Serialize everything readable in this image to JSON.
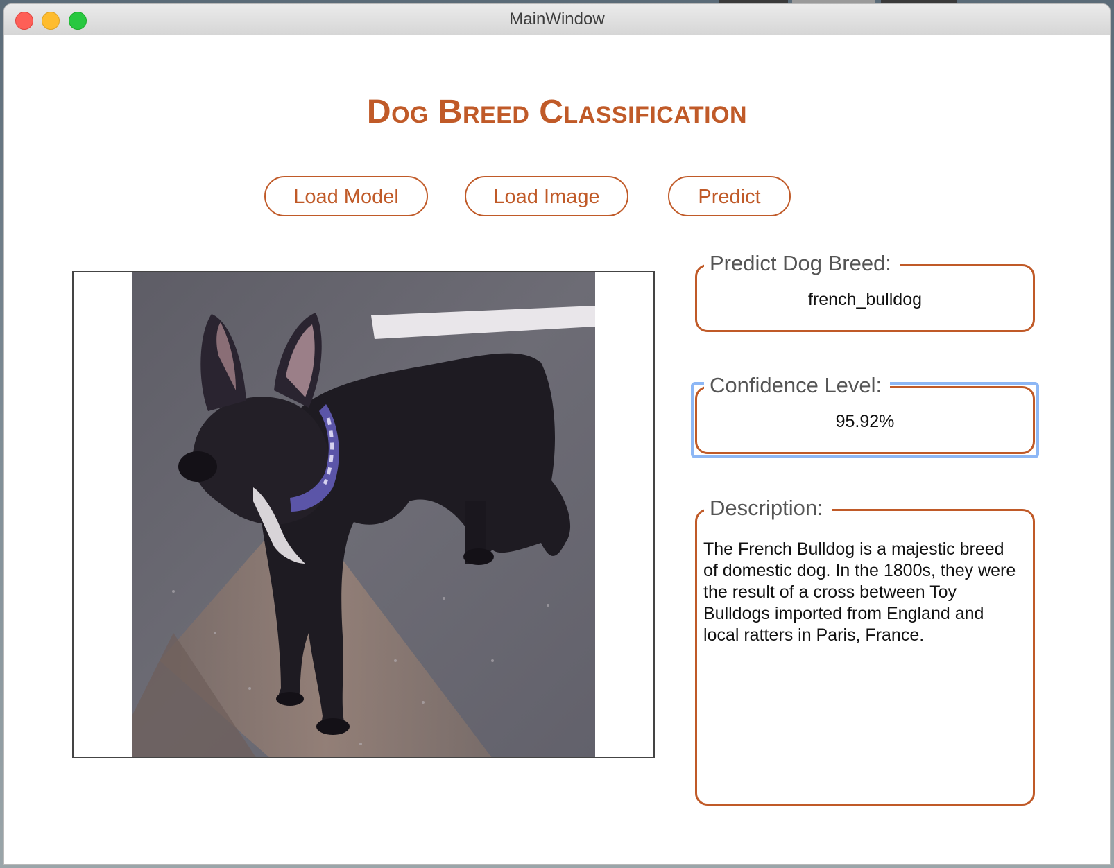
{
  "window": {
    "title": "MainWindow"
  },
  "app": {
    "title": "Dog Breed Classification",
    "accent_color": "#c05a28"
  },
  "toolbar": {
    "load_model_label": "Load Model",
    "load_image_label": "Load Image",
    "predict_label": "Predict"
  },
  "image": {
    "subject": "black french bulldog standing on pavement"
  },
  "results": {
    "breed_label": "Predict Dog Breed:",
    "breed_value": "french_bulldog",
    "confidence_label": "Confidence Level:",
    "confidence_value": "95.92%",
    "description_label": "Description:",
    "description_value": "The French Bulldog is a majestic breed of domestic dog. In the 1800s, they were the result of a cross between Toy Bulldogs imported from England and local ratters in Paris, France."
  }
}
